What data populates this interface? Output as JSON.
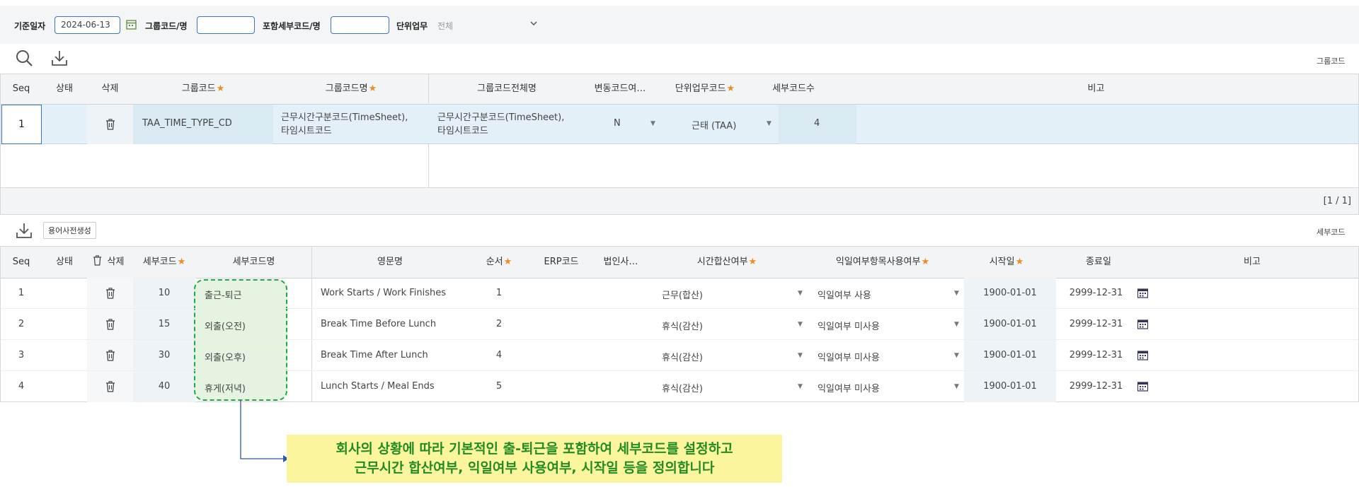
{
  "filter": {
    "base_date_label": "기준일자",
    "base_date_value": "2024-06-13",
    "group_code_label": "그룹코드/명",
    "detail_code_label": "포함세부코드/명",
    "unit_work_label": "단위업무",
    "unit_work_value": "전체"
  },
  "group_section": {
    "label": "그룹코드",
    "columns": [
      "Seq",
      "상태",
      "삭제",
      "그룹코드",
      "그룹코드명",
      "그룹코드전체명",
      "변동코드여…",
      "단위업무코드",
      "세부코드수",
      "비고"
    ],
    "rows": [
      {
        "seq": "1",
        "status": "",
        "group_code": "TAA_TIME_TYPE_CD",
        "group_name_line1": "근무시간구분코드(TimeSheet),",
        "group_name_line2": "타임시트코드",
        "full_name_line1": "근무시간구분코드(TimeSheet),",
        "full_name_line2": "타임시트코드",
        "change_flag": "N",
        "unit_work_code": "근태 (TAA)",
        "detail_count": "4",
        "note": ""
      }
    ],
    "pagination": "[1 / 1]"
  },
  "detail_section": {
    "label": "세부코드",
    "dict_button": "용어사전생성",
    "columns": [
      "Seq",
      "상태",
      "삭제",
      "세부코드",
      "세부코드명",
      "영문명",
      "순서",
      "ERP코드",
      "법인사…",
      "시간합산여부",
      "익일여부항목사용여부",
      "시작일",
      "종료일",
      "비고"
    ],
    "rows": [
      {
        "seq": "1",
        "code": "10",
        "name": "출근-퇴근",
        "en": "Work Starts / Work Finishes",
        "order": "1",
        "sum": "근무(합산)",
        "nextday": "익일여부 사용",
        "start": "1900-01-01",
        "end": "2999-12-31"
      },
      {
        "seq": "2",
        "code": "15",
        "name": "외출(오전)",
        "en": "Break Time Before Lunch",
        "order": "2",
        "sum": "휴식(감산)",
        "nextday": "익일여부 미사용",
        "start": "1900-01-01",
        "end": "2999-12-31"
      },
      {
        "seq": "3",
        "code": "30",
        "name": "외출(오후)",
        "en": "Break Time After Lunch",
        "order": "4",
        "sum": "휴식(감산)",
        "nextday": "익일여부 미사용",
        "start": "1900-01-01",
        "end": "2999-12-31"
      },
      {
        "seq": "4",
        "code": "40",
        "name": "휴게(저녁)",
        "en": "Lunch Starts / Meal Ends",
        "order": "5",
        "sum": "휴식(감산)",
        "nextday": "익일여부 미사용",
        "start": "1900-01-01",
        "end": "2999-12-31"
      }
    ]
  },
  "callout": {
    "line1": "회사의 상황에 따라 기본적인 출-퇴근을 포함하여 세부코드를 설정하고",
    "line2": "근무시간 합산여부, 익일여부 사용여부, 시작일 등을 정의합니다"
  },
  "colors": {
    "accent": "#3d74c6",
    "required": "#f08c1e",
    "selected_row": "#e3f0f7",
    "highlight": "#22a845",
    "callout_bg": "#fbf59e",
    "callout_text": "#228b22"
  },
  "icons": [
    "calendar-icon",
    "search-icon",
    "download-icon",
    "trash-icon",
    "chevron-down-icon",
    "calendar-picker-icon"
  ]
}
